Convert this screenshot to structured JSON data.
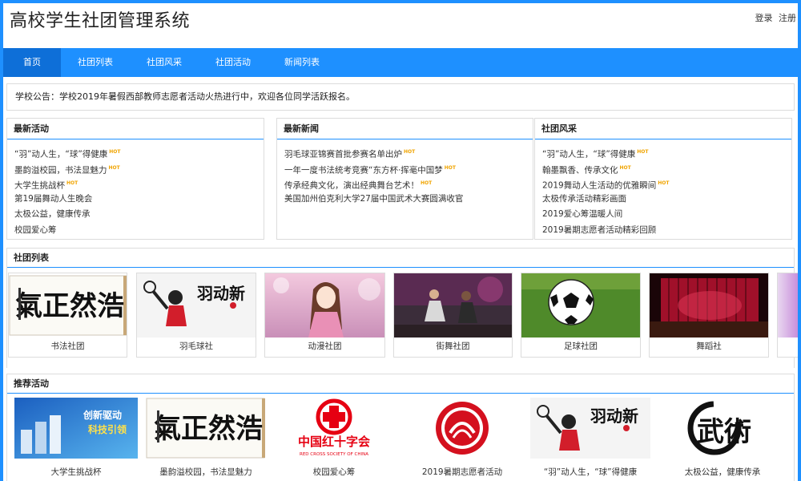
{
  "header": {
    "title": "高校学生社团管理系统",
    "login": "登录",
    "register": "注册"
  },
  "nav": {
    "items": [
      {
        "label": "首页",
        "active": true
      },
      {
        "label": "社团列表"
      },
      {
        "label": "社团风采"
      },
      {
        "label": "社团活动"
      },
      {
        "label": "新闻列表"
      }
    ]
  },
  "notice": {
    "text": "学校公告：学校2019年暑假西部教师志愿者活动火热进行中，欢迎各位同学活跃报名。"
  },
  "hot_label": "HOT",
  "latest_activities": {
    "title": "最新活动",
    "items": [
      {
        "text": "“羽”动人生，“球”得健康",
        "hot": true
      },
      {
        "text": "墨韵溢校园，书法显魅力",
        "hot": true
      },
      {
        "text": "大学生挑战杯",
        "hot": true
      },
      {
        "text": "第19届舞动人生晚会"
      },
      {
        "text": "太极公益，健康传承"
      },
      {
        "text": "校园爱心筹"
      }
    ]
  },
  "latest_news": {
    "title": "最新新闻",
    "items": [
      {
        "text": "羽毛球亚锦赛首批参赛名单出炉",
        "hot": true
      },
      {
        "text": "一年一度书法统考竞赛“东方杯·挥毫中国梦",
        "hot": true
      },
      {
        "text": "传承经典文化，演出经典舞台艺术！",
        "hot": true
      },
      {
        "text": "美国加州伯克利大学27届中国武术大赛圆满收官"
      }
    ]
  },
  "club_style": {
    "title": "社团风采",
    "items": [
      {
        "text": "“羽”动人生，“球”得健康",
        "hot": true
      },
      {
        "text": "翰墨飘香、传承文化",
        "hot": true
      },
      {
        "text": "2019舞动人生活动的优雅瞬间",
        "hot": true
      },
      {
        "text": "太极传承活动精彩画面"
      },
      {
        "text": "2019爱心筹温暖人间"
      },
      {
        "text": "2019暑期志愿者活动精彩回顾"
      }
    ]
  },
  "club_list": {
    "title": "社团列表",
    "items": [
      {
        "name": "书法社团",
        "icon": "calligraphy-image",
        "image_text": "氣正然浩"
      },
      {
        "name": "羽毛球社",
        "icon": "badminton-image",
        "image_text": "羽动新"
      },
      {
        "name": "动漫社团",
        "icon": "anime-girl-image"
      },
      {
        "name": "街舞社团",
        "icon": "street-dance-image"
      },
      {
        "name": "足球社团",
        "icon": "soccer-ball-image"
      },
      {
        "name": "舞蹈社",
        "icon": "stage-curtain-image"
      }
    ]
  },
  "recommended": {
    "title": "推荐活动",
    "items": [
      {
        "name": "大学生挑战杯",
        "icon": "innovation-image",
        "image_text_1": "创新驱动",
        "image_text_2": "科技引领"
      },
      {
        "name": "墨韵溢校园，书法显魅力",
        "icon": "calligraphy-image",
        "image_text": "氣正然浩"
      },
      {
        "name": "校园爱心筹",
        "icon": "red-cross-image",
        "image_text_1": "中国红十字会",
        "image_text_2": "RED CROSS SOCIETY OF CHINA"
      },
      {
        "name": "2019暑期志愿者活动",
        "icon": "volunteer-logo-image"
      },
      {
        "name": "“羽”动人生，“球”得健康",
        "icon": "badminton-image",
        "image_text": "羽动新"
      },
      {
        "name": "太极公益，健康传承",
        "icon": "wushu-image",
        "image_text": "武術"
      }
    ]
  },
  "colors": {
    "accent": "#1e90ff",
    "nav_active": "#0e6fd8",
    "hot": "#f0a400",
    "red_cross": "#e60012"
  }
}
